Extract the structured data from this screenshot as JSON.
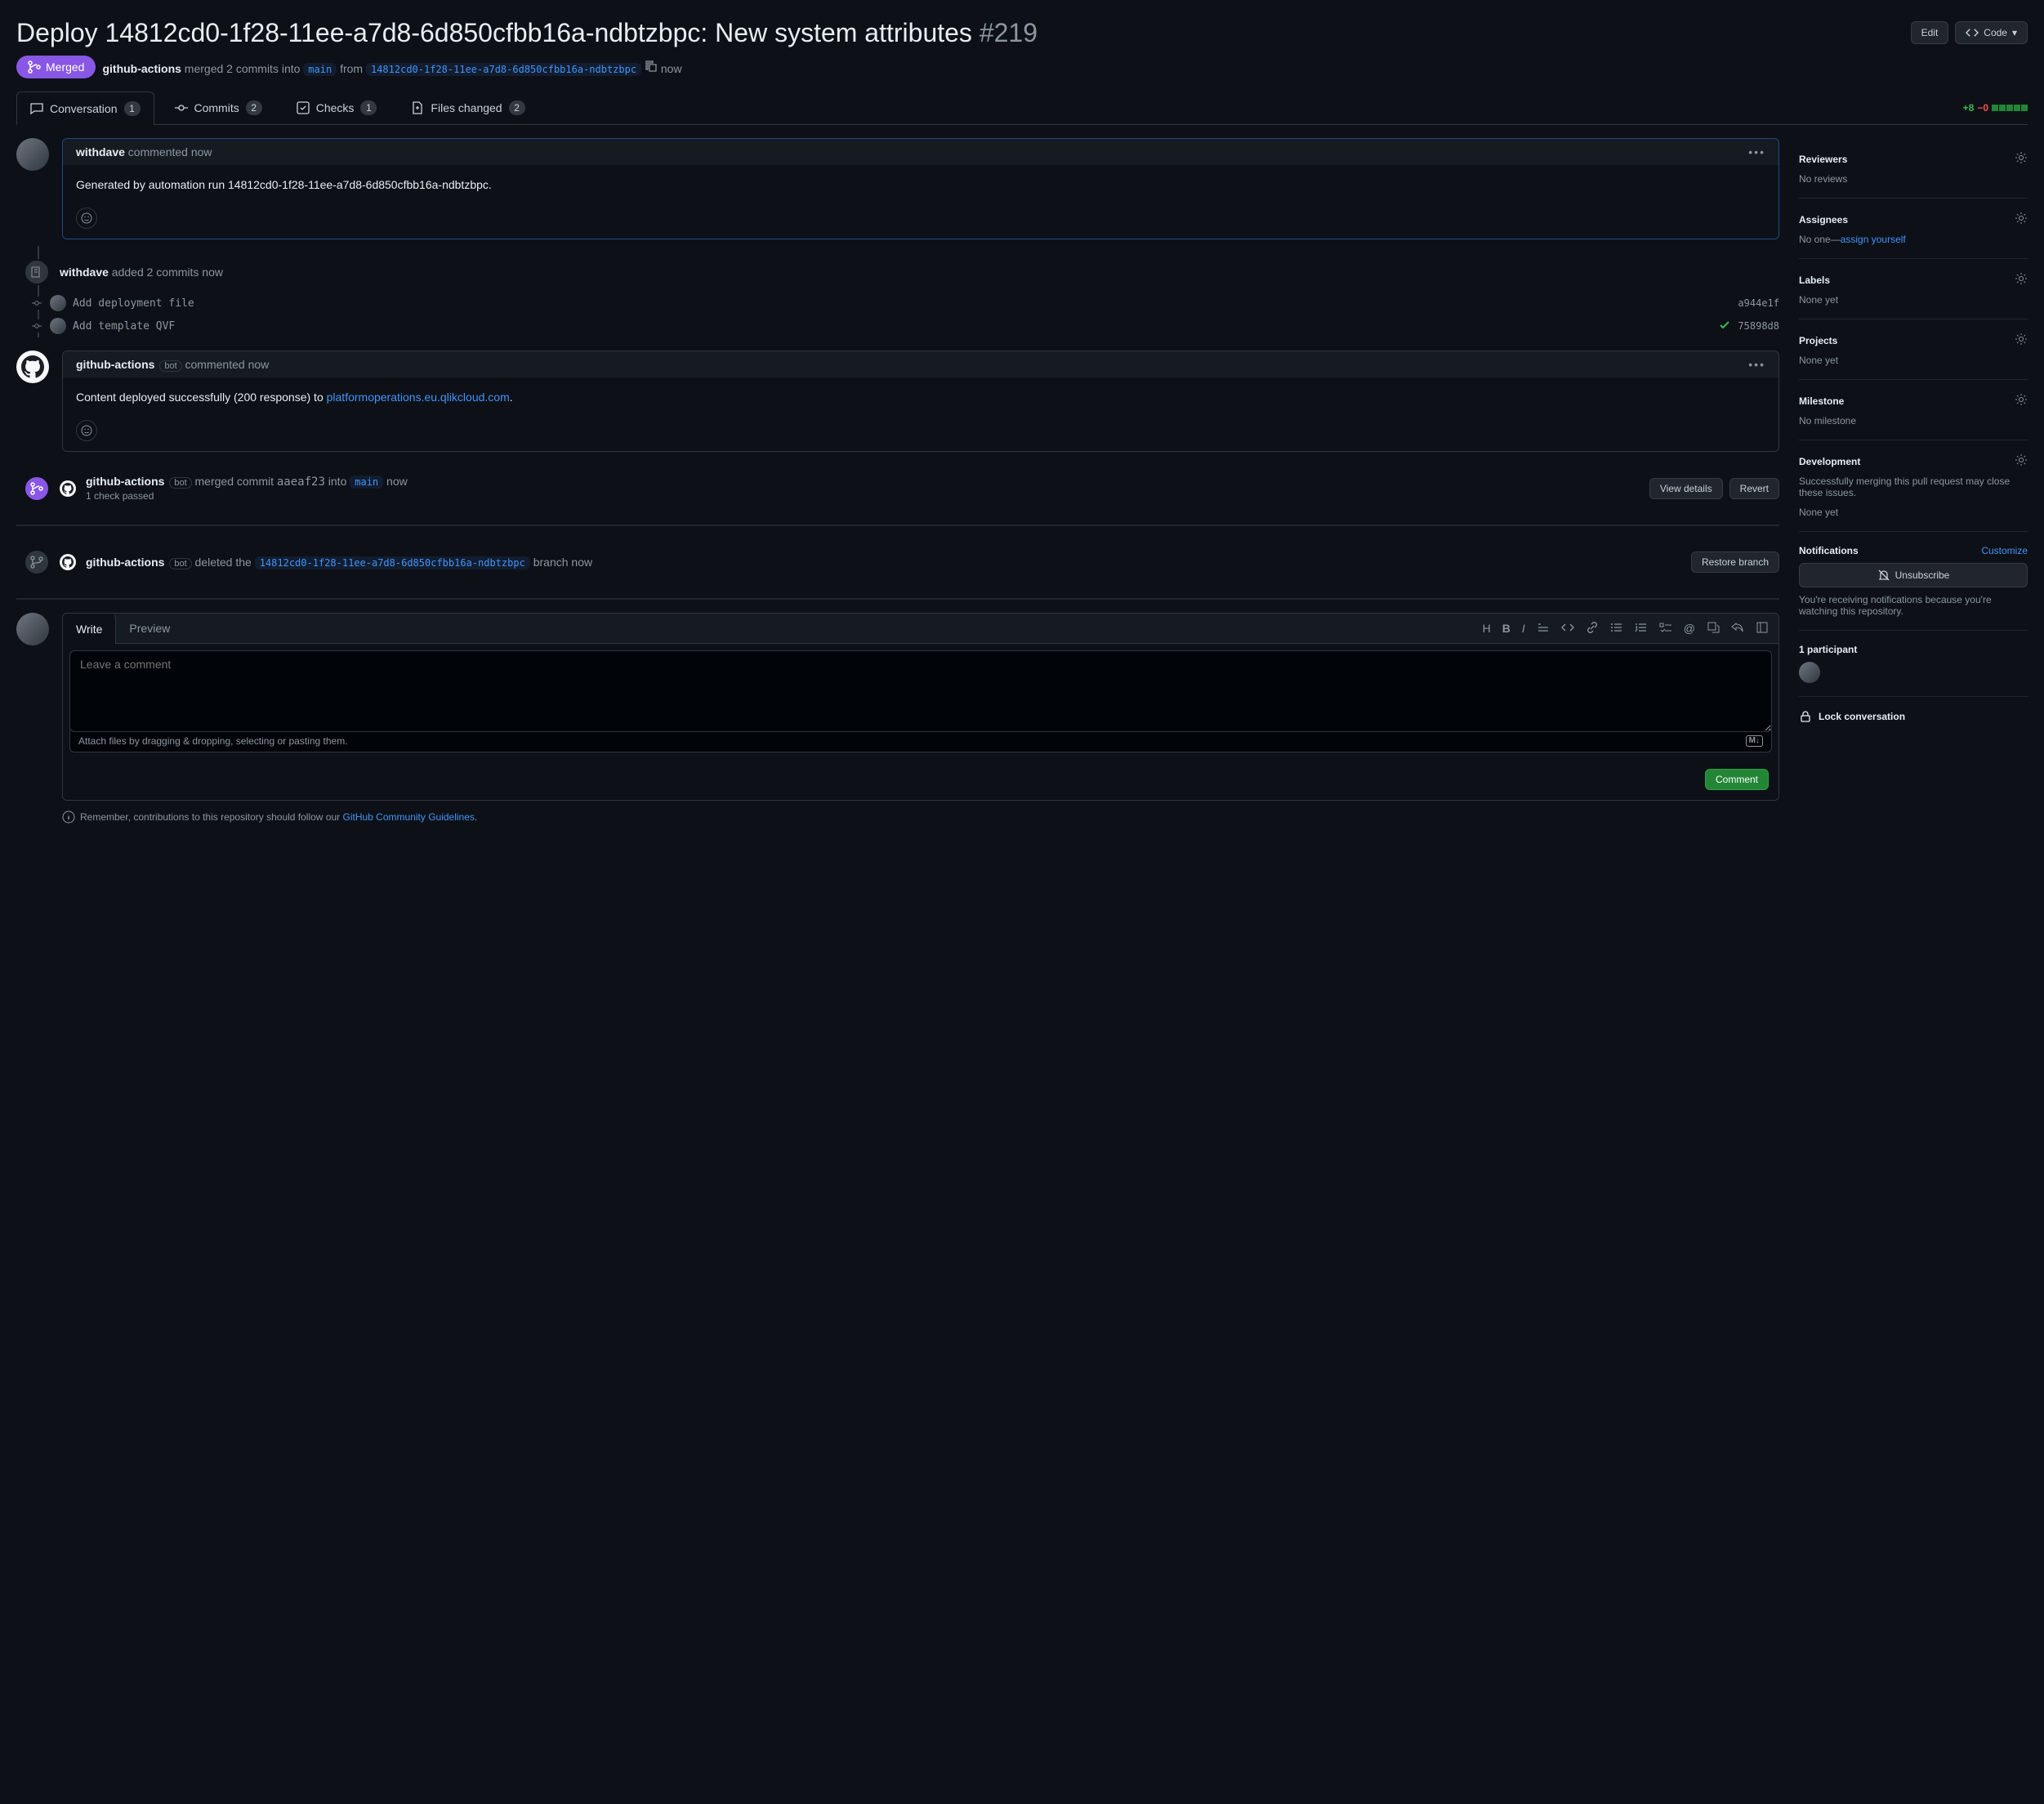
{
  "title": "Deploy 14812cd0-1f28-11ee-a7d8-6d850cfbb16a-ndbtzbpc: New system attributes",
  "pr_number": "#219",
  "edit_btn": "Edit",
  "code_btn": "Code",
  "state": "Merged",
  "merge_line": {
    "actor": "github-actions",
    "text": "merged 2 commits into",
    "base": "main",
    "from_text": "from",
    "head": "14812cd0-1f28-11ee-a7d8-6d850cfbb16a-ndbtzbpc",
    "time": "now"
  },
  "tabs": {
    "conversation": "Conversation",
    "conversation_count": "1",
    "commits": "Commits",
    "commits_count": "2",
    "checks": "Checks",
    "checks_count": "1",
    "files": "Files changed",
    "files_count": "2"
  },
  "diff": {
    "add": "+8",
    "del": "−0"
  },
  "comment1": {
    "author": "withdave",
    "verb": "commented",
    "time": "now",
    "body": "Generated by automation run 14812cd0-1f28-11ee-a7d8-6d850cfbb16a-ndbtzbpc."
  },
  "push_event": {
    "author": "withdave",
    "text": "added 2 commits",
    "time": "now"
  },
  "commits": [
    {
      "msg": "Add deployment file",
      "sha": "a944e1f",
      "check": false
    },
    {
      "msg": "Add template QVF",
      "sha": "75898d8",
      "check": true
    }
  ],
  "comment2": {
    "author": "github-actions",
    "bot": "bot",
    "verb": "commented",
    "time": "now",
    "body_prefix": "Content deployed successfully (200 response) to ",
    "link": "platformoperations.eu.qlikcloud.com",
    "body_suffix": "."
  },
  "merge_event": {
    "author": "github-actions",
    "bot": "bot",
    "text1": "merged commit",
    "sha": "aaeaf23",
    "text2": "into",
    "branch": "main",
    "time": "now",
    "checks": "1 check passed",
    "view": "View details",
    "revert": "Revert"
  },
  "delete_event": {
    "author": "github-actions",
    "bot": "bot",
    "text": "deleted the",
    "branch": "14812cd0-1f28-11ee-a7d8-6d850cfbb16a-ndbtzbpc",
    "suffix": "branch",
    "time": "now",
    "restore": "Restore branch"
  },
  "form": {
    "write": "Write",
    "preview": "Preview",
    "placeholder": "Leave a comment",
    "attach": "Attach files by dragging & dropping, selecting or pasting them.",
    "submit": "Comment"
  },
  "guideline": {
    "prefix": "Remember, contributions to this repository should follow our ",
    "link": "GitHub Community Guidelines",
    "suffix": "."
  },
  "sidebar": {
    "reviewers": {
      "title": "Reviewers",
      "body": "No reviews"
    },
    "assignees": {
      "title": "Assignees",
      "prefix": "No one—",
      "link": "assign yourself"
    },
    "labels": {
      "title": "Labels",
      "body": "None yet"
    },
    "projects": {
      "title": "Projects",
      "body": "None yet"
    },
    "milestone": {
      "title": "Milestone",
      "body": "No milestone"
    },
    "development": {
      "title": "Development",
      "body1": "Successfully merging this pull request may close these issues.",
      "body2": "None yet"
    },
    "notifications": {
      "title": "Notifications",
      "customize": "Customize",
      "unsubscribe": "Unsubscribe",
      "note": "You're receiving notifications because you're watching this repository."
    },
    "participants": "1 participant",
    "lock": "Lock conversation"
  }
}
